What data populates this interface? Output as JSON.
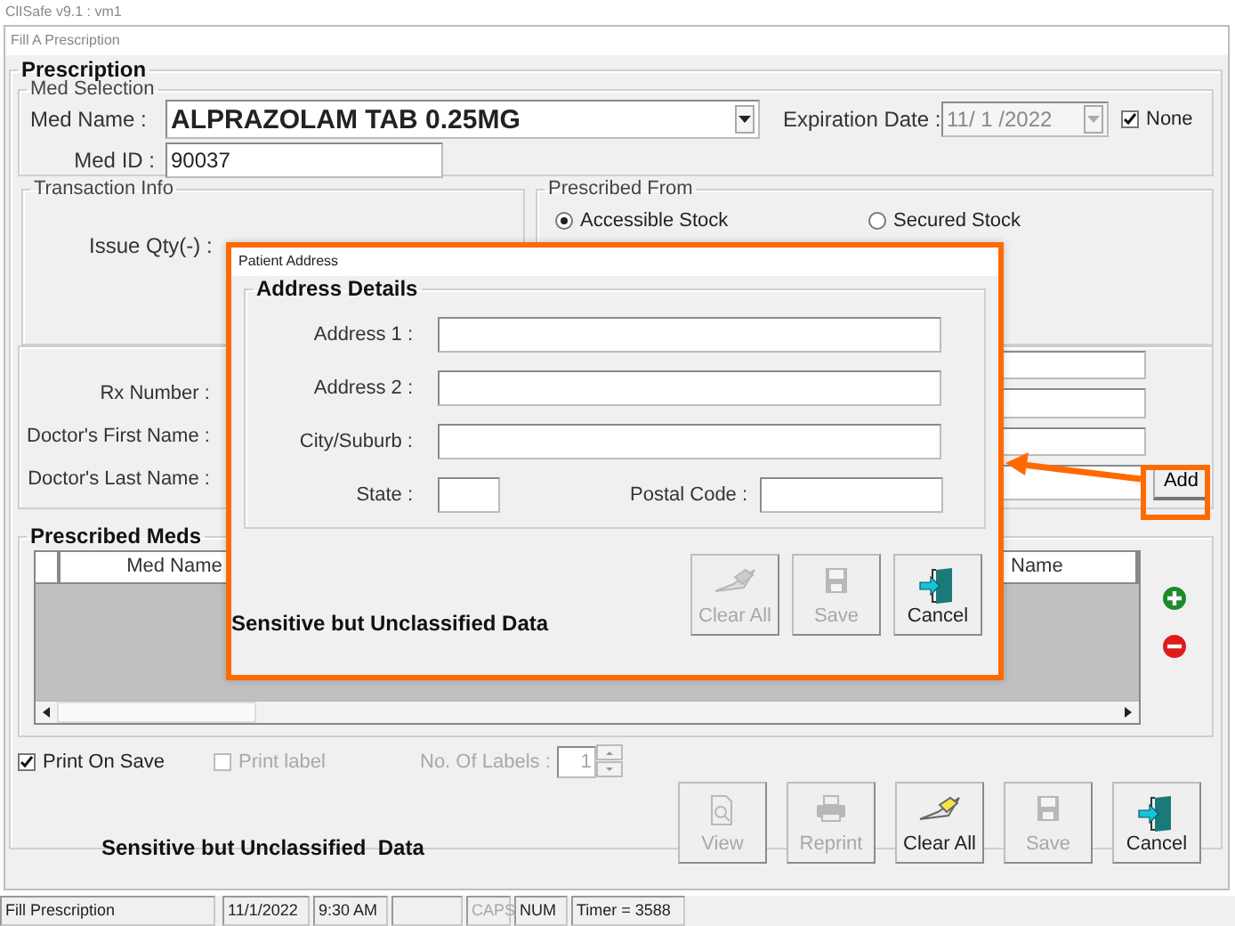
{
  "app_title": "ClISafe v9.1 : vm1",
  "window": {
    "title": "Fill A Prescription"
  },
  "prescription": {
    "title": "Prescription",
    "med_selection": {
      "title": "Med Selection",
      "med_name_label": "Med Name :",
      "med_name": "ALPRAZOLAM TAB 0.25MG",
      "expiration_label": "Expiration Date :",
      "expiration_date": "11/ 1 /2022",
      "none_checkbox": {
        "label": "None",
        "checked": true
      },
      "med_id_label": "Med ID :",
      "med_id": "90037"
    },
    "transaction_info": {
      "title": "Transaction Info",
      "issue_qty_label": "Issue Qty(-) :"
    },
    "prescribed_from": {
      "title": "Prescribed From",
      "options": [
        {
          "label": "Accessible Stock",
          "selected": true
        },
        {
          "label": "Secured Stock",
          "selected": false
        }
      ]
    },
    "prescriber": {
      "labels": [
        "Rx Number :",
        "Doctor's First Name :",
        "Doctor's Last Name :"
      ],
      "add_button": "Add"
    },
    "prescribed_meds": {
      "title": "Prescribed Meds",
      "columns": [
        "Med Name",
        "Name"
      ]
    }
  },
  "print_options": [
    {
      "label": "Print On Save",
      "checked": true,
      "disabled": false
    },
    {
      "label": "Print label",
      "checked": false,
      "disabled": true
    }
  ],
  "labels_count": {
    "label": "No. Of Labels :",
    "value": "1"
  },
  "notice": "Sensitive but Unclassified  Data",
  "buttons": [
    {
      "label": "View",
      "kind": "view",
      "disabled": true
    },
    {
      "label": "Reprint",
      "kind": "print",
      "disabled": true
    },
    {
      "label": "Clear All",
      "kind": "eraser",
      "disabled": false
    },
    {
      "label": "Save",
      "kind": "floppy",
      "disabled": true
    },
    {
      "label": "Cancel",
      "kind": "exit",
      "disabled": false
    }
  ],
  "status_bar": [
    {
      "text": "Fill Prescription",
      "disabled": false
    },
    {
      "text": "11/1/2022",
      "disabled": false
    },
    {
      "text": "9:30 AM",
      "disabled": false
    },
    {
      "text": "CAPS",
      "disabled": true
    },
    {
      "text": "NUM",
      "disabled": false
    },
    {
      "text": "Timer = 3588",
      "disabled": false
    }
  ],
  "dialog": {
    "title": "Patient Address",
    "group": "Address Details",
    "fields": [
      {
        "label": "Address 1 :",
        "kind": "wide"
      },
      {
        "label": "Address 2 :",
        "kind": "wide"
      },
      {
        "label": "City/Suburb :",
        "kind": "wide"
      },
      {
        "label": "State :",
        "kind": "short"
      },
      {
        "label": "Postal Code :",
        "kind": "paired"
      }
    ],
    "notice": "Sensitive but Unclassified Data",
    "buttons": [
      {
        "label": "Clear All",
        "kind": "eraser",
        "disabled": true
      },
      {
        "label": "Save",
        "kind": "floppy",
        "disabled": true
      },
      {
        "label": "Cancel",
        "kind": "exit",
        "disabled": false
      }
    ]
  }
}
